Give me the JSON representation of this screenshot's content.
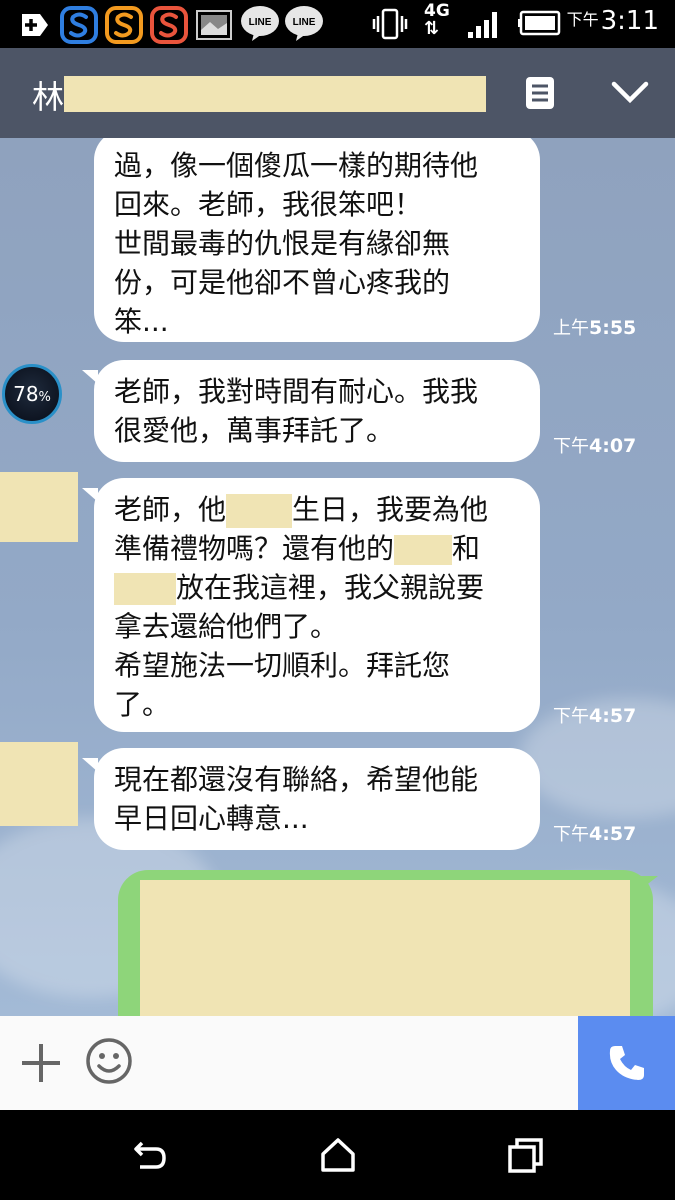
{
  "status_bar": {
    "time": "3:11",
    "ampm": "下午",
    "network": "4G",
    "icons": [
      "add-box-icon",
      "s-app-icon-blue",
      "s-app-icon-orange",
      "s-app-icon-red",
      "gallery-icon",
      "line-icon",
      "line-icon",
      "vibrate-icon",
      "signal-icon",
      "battery-icon"
    ],
    "line_label": "LINE"
  },
  "header": {
    "title": "林",
    "icons": [
      "notes-icon",
      "chevron-down-icon"
    ]
  },
  "messages": [
    {
      "lines": [
        "過，像一個傻瓜一樣的期待他",
        "回來。老師，我很笨吧！",
        "世間最毒的仇恨是有緣卻無",
        "份，可是他卻不曾心疼我的",
        "笨..."
      ],
      "ampm": "上午",
      "time": "5:55"
    },
    {
      "lines": [
        "老師，我對時間有耐心。我我",
        "很愛他，萬事拜託了。"
      ],
      "ampm": "下午",
      "time": "4:07",
      "avatar_badge": "78",
      "avatar_badge_unit": "%"
    },
    {
      "line1_a": "老師，他",
      "line1_b": "生日，我要為他",
      "line2_a": "準備禮物嗎？還有他的",
      "line2_b": "和",
      "line3_b": "放在我這裡，我父親說要",
      "line4": "拿去還給他們了。",
      "line5": "希望施法一切順利。拜託您",
      "line6": "了。",
      "ampm": "下午",
      "time": "4:57"
    },
    {
      "lines": [
        "現在都還沒有聯絡，希望他能",
        "早日回心轉意..."
      ],
      "ampm": "下午",
      "time": "4:57"
    }
  ],
  "colors": {
    "header_bg": "#4d5566",
    "chat_bg": "#93a9c7",
    "sent_bubble": "#8ed57a",
    "received_bubble": "#ffffff",
    "call_button": "#5b8cf0",
    "redaction": "#f0e4b4"
  },
  "input_bar": {
    "icons": [
      "plus-icon",
      "emoji-icon",
      "phone-icon"
    ]
  },
  "nav_bar": {
    "icons": [
      "back-icon",
      "home-icon",
      "recents-icon"
    ]
  }
}
